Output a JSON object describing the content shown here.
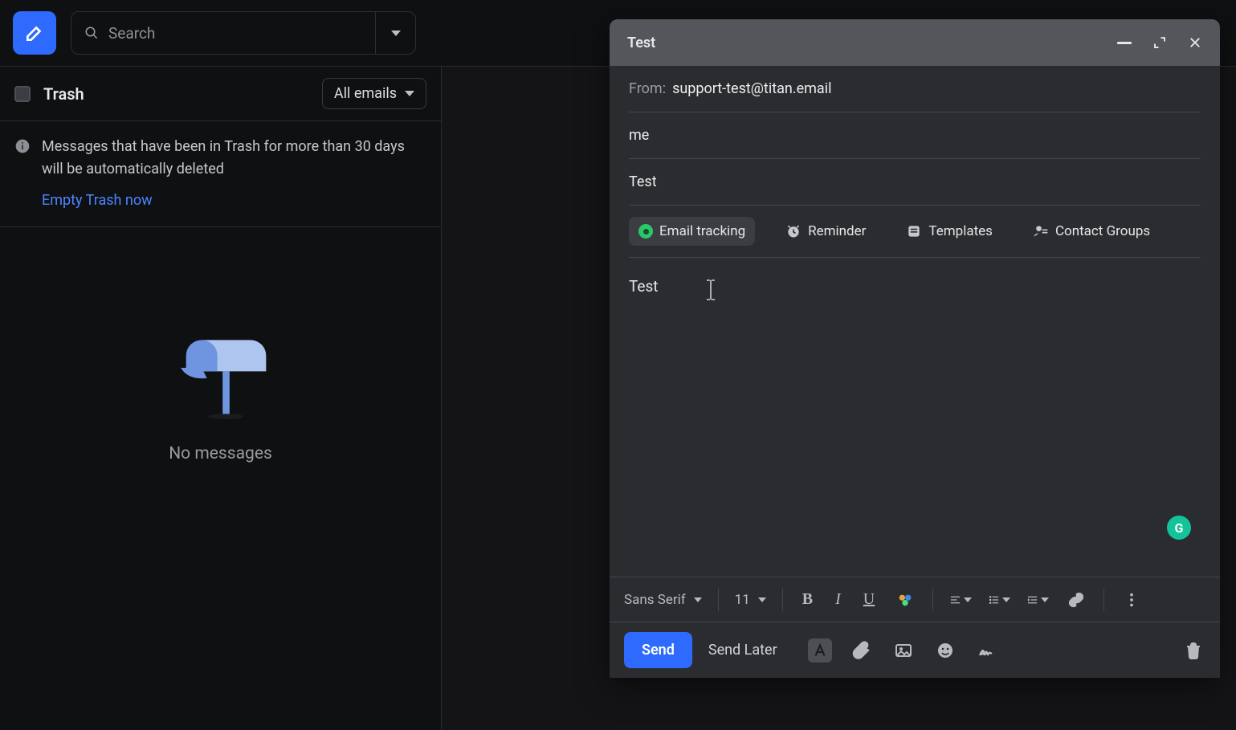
{
  "topbar": {
    "search_placeholder": "Search"
  },
  "folder": {
    "name": "Trash",
    "filter_selected": "All emails",
    "info_message": "Messages that have been in Trash for more than 30 days will be automatically deleted",
    "empty_link_label": "Empty Trash now",
    "empty_state_label": "No messages"
  },
  "compose": {
    "title": "Test",
    "from_label": "From:",
    "from_value": "support-test@titan.email",
    "to_value": "me",
    "subject_value": "Test",
    "features": {
      "tracking": "Email tracking",
      "reminder": "Reminder",
      "templates": "Templates",
      "contact_groups": "Contact Groups"
    },
    "body": "Test",
    "format": {
      "font_family": "Sans Serif",
      "font_size": "11"
    },
    "send_label": "Send",
    "send_later_label": "Send Later"
  }
}
